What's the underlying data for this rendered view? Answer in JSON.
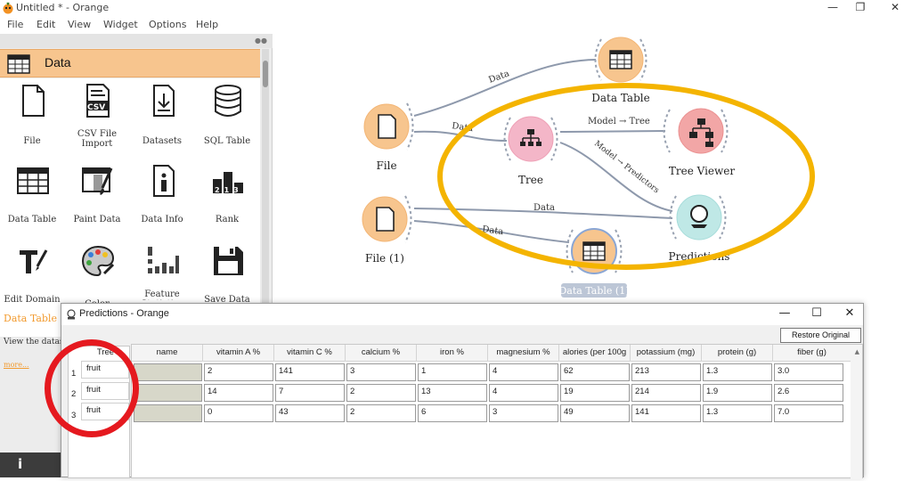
{
  "window": {
    "title": "Untitled * - Orange",
    "controls": {
      "minimize": "—",
      "restore": "❐",
      "close": "✕"
    }
  },
  "menu": [
    "File",
    "Edit",
    "View",
    "Widget",
    "Options",
    "Help"
  ],
  "toolbox": {
    "category": "Data",
    "widgets": [
      {
        "label": "File",
        "icon": "file-icon"
      },
      {
        "label": "CSV File Import",
        "icon": "csv-icon"
      },
      {
        "label": "Datasets",
        "icon": "datasets-icon"
      },
      {
        "label": "SQL Table",
        "icon": "database-icon"
      },
      {
        "label": "Data Table",
        "icon": "table-icon"
      },
      {
        "label": "Paint Data",
        "icon": "paint-icon"
      },
      {
        "label": "Data Info",
        "icon": "info-icon"
      },
      {
        "label": "Rank",
        "icon": "rank-icon"
      },
      {
        "label": "Edit Domain",
        "icon": "edit-domain-icon"
      },
      {
        "label": "Color",
        "icon": "palette-icon"
      },
      {
        "label": "Feature Statistics",
        "icon": "bar-chart-icon"
      },
      {
        "label": "Save Data",
        "icon": "save-icon"
      }
    ],
    "csv_badge": "CSV",
    "rank_badge": "213",
    "info_title": "Data Table",
    "info_desc": "View the dataset",
    "info_more": "more...",
    "info_button": "i"
  },
  "canvas": {
    "nodes": {
      "file": "File",
      "file1": "File (1)",
      "data_table": "Data Table",
      "tree": "Tree",
      "tree_viewer": "Tree Viewer",
      "predictions": "Predictions",
      "data_table1": "Data Table (1)"
    },
    "links": {
      "file_data_table": "Data",
      "file_tree": "Data",
      "tree_tree_viewer": "Model → Tree",
      "tree_predictions": "Model → Predictors",
      "file1_predictions": "Data",
      "file1_data_table1": "Data"
    },
    "highlight_color": "#f4b400"
  },
  "dialog": {
    "title": "Predictions - Orange",
    "controls": {
      "minimize": "—",
      "maximize": "☐",
      "close": "✕"
    },
    "restore_button": "Restore Original Order",
    "tree_column": {
      "header": "Tree",
      "rows": [
        "fruit",
        "fruit",
        "fruit"
      ],
      "row_numbers": [
        "1",
        "2",
        "3"
      ]
    },
    "table": {
      "columns": [
        "name",
        "vitamin A %",
        "vitamin C %",
        "calcium %",
        "iron %",
        "magnesium %",
        "alories (per 100g",
        "potassium (mg)",
        "protein (g)",
        "fiber (g)"
      ],
      "rows": [
        [
          "",
          "2",
          "141",
          "3",
          "1",
          "4",
          "62",
          "213",
          "1.3",
          "3.0"
        ],
        [
          "",
          "14",
          "7",
          "2",
          "13",
          "4",
          "19",
          "214",
          "1.9",
          "2.6"
        ],
        [
          "",
          "0",
          "43",
          "2",
          "6",
          "3",
          "49",
          "141",
          "1.3",
          "7.0"
        ]
      ]
    },
    "highlight_color": "#e5191f"
  },
  "colors": {
    "data_orange": "#f7c58e",
    "model_pink": "#f4b6c8",
    "viewer_red": "#f2a6a6",
    "predict_teal": "#bfe8e6"
  }
}
